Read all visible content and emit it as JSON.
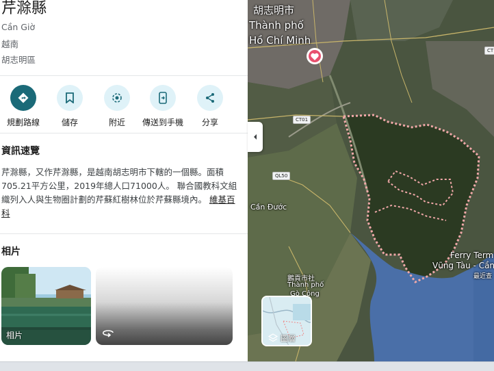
{
  "place": {
    "title": "芹滁縣",
    "line1": "Cần Giờ",
    "line2": "越南",
    "line3": "胡志明區"
  },
  "actions": [
    {
      "label": "規劃路線",
      "icon": "directions-icon"
    },
    {
      "label": "儲存",
      "icon": "bookmark-icon"
    },
    {
      "label": "附近",
      "icon": "nearby-icon"
    },
    {
      "label": "傳送到手機",
      "icon": "send-to-phone-icon"
    },
    {
      "label": "分享",
      "icon": "share-icon"
    }
  ],
  "overview": {
    "heading": "資訊速覽",
    "text": "芹滁縣，又作芹滁縣，是越南胡志明市下轄的一個縣。面積705.21平方公里，2019年總人口71000人。 聯合國教科文組織列入人與生物圈計劃的芹蘇紅樹林位於芹蘇縣境內。",
    "link": "維基百科"
  },
  "photos": {
    "heading": "相片",
    "first_label": "相片"
  },
  "map": {
    "city_line1": "胡志明市",
    "city_line2": "Thành phố",
    "city_line3": "Hồ Chí Minh",
    "road_ct01": "CT01",
    "road_ql50": "QL50",
    "road_right": "CT",
    "can_duoc": "Cần Đước",
    "go_cong_1": "鵝貢市社",
    "go_cong_2": "Thành phố",
    "go_cong_3": "Gò Công",
    "ferry_1": "Ferry Term",
    "ferry_2": "Vũng Tàu - Cần",
    "ferry_3": "最近查",
    "layers_label": "圖層",
    "boundary_color": "#f0a8a8",
    "water_color": "#4a6fa8"
  }
}
